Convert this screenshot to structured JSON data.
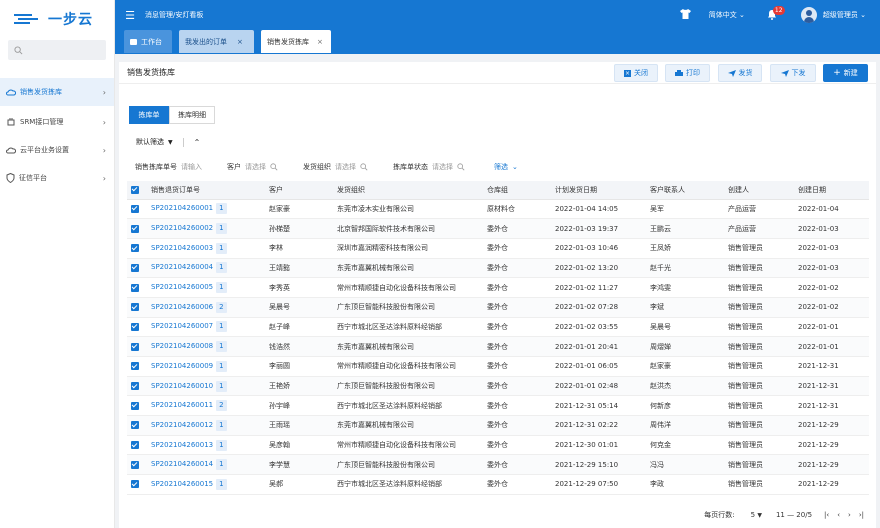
{
  "brand": {
    "name": "一步云"
  },
  "sidebar": {
    "search_placeholder": "",
    "items": [
      {
        "label": "销售发货拣库",
        "icon": "cloud-icon",
        "active": true
      },
      {
        "label": "SRM接口管理",
        "icon": "plug-icon",
        "active": false
      },
      {
        "label": "云平台业务设置",
        "icon": "cloud-settings-icon",
        "active": false
      },
      {
        "label": "征信平台",
        "icon": "shield-icon",
        "active": false
      }
    ]
  },
  "topbar": {
    "breadcrumb": "消息管理/安灯看板",
    "language": "简体中文",
    "notification_count": "12",
    "user_name": "超级管理员"
  },
  "tabs": [
    {
      "label": "工作台"
    },
    {
      "label": "我发出的订单"
    },
    {
      "label": "销售发货拣库"
    }
  ],
  "page": {
    "title": "销售发货拣库",
    "buttons": {
      "close": "关闭",
      "print": "打印",
      "ship": "发货",
      "dispatch": "下发",
      "new": "新建"
    },
    "subtabs": [
      "拣库单",
      "拣库明细"
    ],
    "default_filter": "默认筛选",
    "filters": [
      {
        "label": "销售拣库单号",
        "placeholder": "请输入"
      },
      {
        "label": "客户",
        "placeholder": "请选择"
      },
      {
        "label": "发货组织",
        "placeholder": "请选择"
      },
      {
        "label": "拣库单状态",
        "placeholder": "请选择"
      }
    ],
    "filter_more": "筛选"
  },
  "table": {
    "columns": [
      "销售退货订单号",
      "客户",
      "发货组织",
      "仓库组",
      "计划发货日期",
      "客户联系人",
      "创建人",
      "创建日期"
    ],
    "rows": [
      [
        "SP202104260001",
        "1",
        "赵家豪",
        "东莞市凌木实业有限公司",
        "原材料仓",
        "2022-01-04 14:05",
        "吴军",
        "产品运营",
        "2022-01-04"
      ],
      [
        "SP202104260002",
        "1",
        "孙梯楚",
        "北京智邦国际软件技术有限公司",
        "委外仓",
        "2022-01-03 19:37",
        "王鹏云",
        "产品运营",
        "2022-01-03"
      ],
      [
        "SP202104260003",
        "1",
        "李林",
        "深圳市嘉润精密科技有限公司",
        "委外仓",
        "2022-01-03 10:46",
        "王凤娇",
        "销售管理员",
        "2022-01-03"
      ],
      [
        "SP202104260004",
        "1",
        "王靖懿",
        "东莞市嘉翼机械有限公司",
        "委外仓",
        "2022-01-02 13:20",
        "赵千光",
        "销售管理员",
        "2022-01-03"
      ],
      [
        "SP202104260005",
        "1",
        "李秀英",
        "常州市精顺捷自动化设备科技有限公司",
        "委外仓",
        "2022-01-02 11:27",
        "李鸿雯",
        "销售管理员",
        "2022-01-02"
      ],
      [
        "SP202104260006",
        "2",
        "吴晨号",
        "广东顶巨智能科技股份有限公司",
        "委外仓",
        "2022-01-02 07:28",
        "李斌",
        "销售管理员",
        "2022-01-02"
      ],
      [
        "SP202104260007",
        "1",
        "赵子峰",
        "西宁市城北区圣达涂料原料经销部",
        "委外仓",
        "2022-01-02 03:55",
        "吴晨号",
        "销售管理员",
        "2022-01-01"
      ],
      [
        "SP202104260008",
        "1",
        "钱浩然",
        "东莞市嘉翼机械有限公司",
        "委外仓",
        "2022-01-01 20:41",
        "周熠婵",
        "销售管理员",
        "2022-01-01"
      ],
      [
        "SP202104260009",
        "1",
        "李丽圆",
        "常州市精顺捷自动化设备科技有限公司",
        "委外仓",
        "2022-01-01 06:05",
        "赵家豪",
        "销售管理员",
        "2021-12-31"
      ],
      [
        "SP202104260010",
        "1",
        "王艳娇",
        "广东顶巨智能科技股份有限公司",
        "委外仓",
        "2022-01-01 02:48",
        "赵洪杰",
        "销售管理员",
        "2021-12-31"
      ],
      [
        "SP202104260011",
        "2",
        "孙宇峰",
        "西宁市城北区圣达涂料原料经销部",
        "委外仓",
        "2021-12-31 05:14",
        "何新彦",
        "销售管理员",
        "2021-12-31"
      ],
      [
        "SP202104260012",
        "1",
        "王雨瑶",
        "东莞市嘉翼机械有限公司",
        "委外仓",
        "2021-12-31 02:22",
        "周伟洋",
        "销售管理员",
        "2021-12-29"
      ],
      [
        "SP202104260013",
        "1",
        "吴彦翰",
        "常州市精顺捷自动化设备科技有限公司",
        "委外仓",
        "2021-12-30 01:01",
        "何克金",
        "销售管理员",
        "2021-12-29"
      ],
      [
        "SP202104260014",
        "1",
        "李学慧",
        "广东顶巨智能科技股份有限公司",
        "委外仓",
        "2021-12-29 15:10",
        "冯冯",
        "销售管理员",
        "2021-12-29"
      ],
      [
        "SP202104260015",
        "1",
        "吴郝",
        "西宁市城北区圣达涂料原料经销部",
        "委外仓",
        "2021-12-29 07:50",
        "李政",
        "销售管理员",
        "2021-12-29"
      ]
    ]
  },
  "pager": {
    "per_page_label": "每页行数:",
    "per_page": "5",
    "range": "11 — 20/5"
  },
  "colors": {
    "primary": "#1677d2",
    "badge": "#e53935"
  }
}
